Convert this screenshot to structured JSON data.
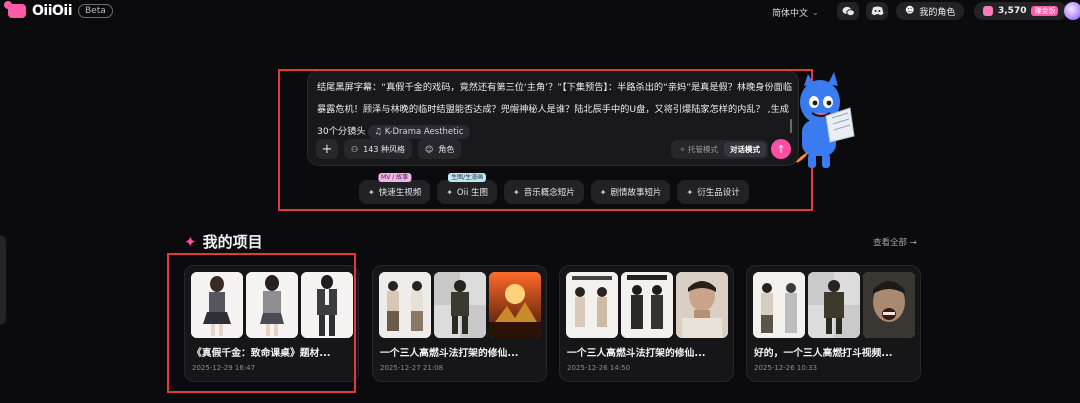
{
  "app": {
    "logo": "OiiOii",
    "badge": "Beta"
  },
  "topbar": {
    "language": "简体中文",
    "my_role": "我的角色",
    "credits": "3,570",
    "earn_label": "赚金饭"
  },
  "prompt": {
    "text": "结尾黑屏字幕：“真假千金的戏码，竟然还有第三位‘主角’？”【下集预告】：半路杀出的“亲妈”是真是假？林晚身份面临暴露危机！顾泽与林晚的临时结盟能否达成？兜帽神秘人是谁？陆北辰手中的U盘，又将引爆陆家怎样的内乱？ ,生成30个分镜头",
    "style_tag": "K-Drama Aesthetic",
    "add_label": "+",
    "styles_label": "143 种风格",
    "role_label": "角色",
    "mode_auto": "托管模式",
    "mode_chat": "对话模式",
    "send_label": "↑"
  },
  "quick_chips": [
    {
      "label": "快速生视频",
      "tag": "MV / 故事",
      "tag_color": "#f3b5e8"
    },
    {
      "label": "Oii 生图",
      "tag": "生图/生漫画",
      "tag_color": "#b9ecef"
    },
    {
      "label": "音乐概念短片",
      "tag": ""
    },
    {
      "label": "剧情故事短片",
      "tag": ""
    },
    {
      "label": "衍生品设计",
      "tag": ""
    }
  ],
  "projects": {
    "title": "我的项目",
    "see_all": "查看全部 →",
    "items": [
      {
        "title": "《真假千金：致命课桌》题材...",
        "date": "2025-12-29 16:47"
      },
      {
        "title": "一个三人高燃斗法打架的修仙...",
        "date": "2025-12-27 21:08"
      },
      {
        "title": "一个三人高燃斗法打架的修仙...",
        "date": "2025-12-26 14:50"
      },
      {
        "title": "好的，一个三人高燃打斗视频...",
        "date": "2025-12-26 10:33"
      }
    ]
  },
  "colors": {
    "accent": "#ff4fa3",
    "highlight_box": "#e0393e",
    "background": "#0b0b0d"
  }
}
